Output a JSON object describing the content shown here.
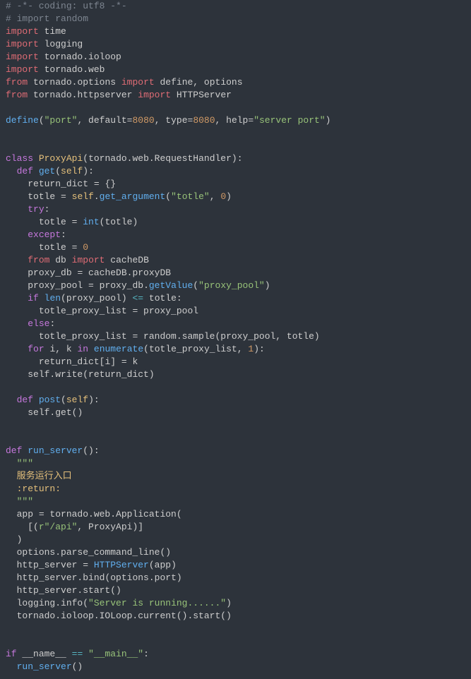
{
  "code": {
    "l01a": "# -*- coding: utf8 -*-",
    "l02a": "# import random",
    "imp": "import",
    "frm": "from",
    "mod_random": "random",
    "mod_time": "time",
    "mod_logging": "logging",
    "mod_tornado_ioloop": "tornado.ioloop",
    "mod_tornado_web": "tornado.web",
    "mod_tornado_options": "tornado.options",
    "mod_tornado_httpserver": "tornado.httpserver",
    "imp_define_options": "define, options",
    "imp_httpserver": "HTTPServer",
    "define": "define",
    "str_port": "\"port\"",
    "default_kw": "default",
    "type_kw": "type",
    "help_kw": "help",
    "n8080_a": "8080",
    "n8080_b": "8080",
    "str_serverport": "\"server port\"",
    "kw_class": "class",
    "cls_proxyapi": "ProxyApi",
    "cls_requesthandler": "tornado.web.RequestHandler",
    "kw_def": "def",
    "fn_get": "get",
    "fn_post": "post",
    "fn_runserver": "run_server",
    "self": "self",
    "return_dict": "return_dict",
    "totle": "totle",
    "get_argument": "get_argument",
    "str_totle": "\"totle\"",
    "n0": "0",
    "kw_try": "try",
    "int": "int",
    "kw_except": "except",
    "n0b": "0",
    "mod_db": "db",
    "imp_cachedb": "cacheDB",
    "proxy_db": "proxy_db",
    "cachedb_proxydb": "cacheDB.proxyDB",
    "proxy_pool": "proxy_pool",
    "getvalue": "getValue",
    "str_proxypool": "\"proxy_pool\"",
    "kw_if": "if",
    "len": "len",
    "kw_else": "else",
    "totle_proxy_list": "totle_proxy_list",
    "random_sample": "random.sample",
    "kw_for": "for",
    "kw_in": "in",
    "i": "i",
    "k": "k",
    "enumerate": "enumerate",
    "n1": "1",
    "self_write": "self.write",
    "self_get": "self.get",
    "docq": "\"\"\"",
    "doc_l1": "服务运行入口",
    "doc_l2": ":return:",
    "app": "app",
    "tornado_web_app": "tornado.web.Application",
    "str_rapi": "r\"/api\"",
    "proxyapi": "ProxyApi",
    "options_parse": "options.parse_command_line",
    "http_server": "http_server",
    "httpserver2": "HTTPServer",
    "http_bind": "http_server.bind",
    "options_port": "options.port",
    "http_start": "http_server.start",
    "logging_info": "logging.info",
    "str_running": "\"Server is running......\"",
    "tornado_ioloop_start": "tornado.ioloop.IOLoop.current().start",
    "name": "__name__",
    "str_main": "\"__main__\"",
    "runserver_call": "run_server"
  }
}
